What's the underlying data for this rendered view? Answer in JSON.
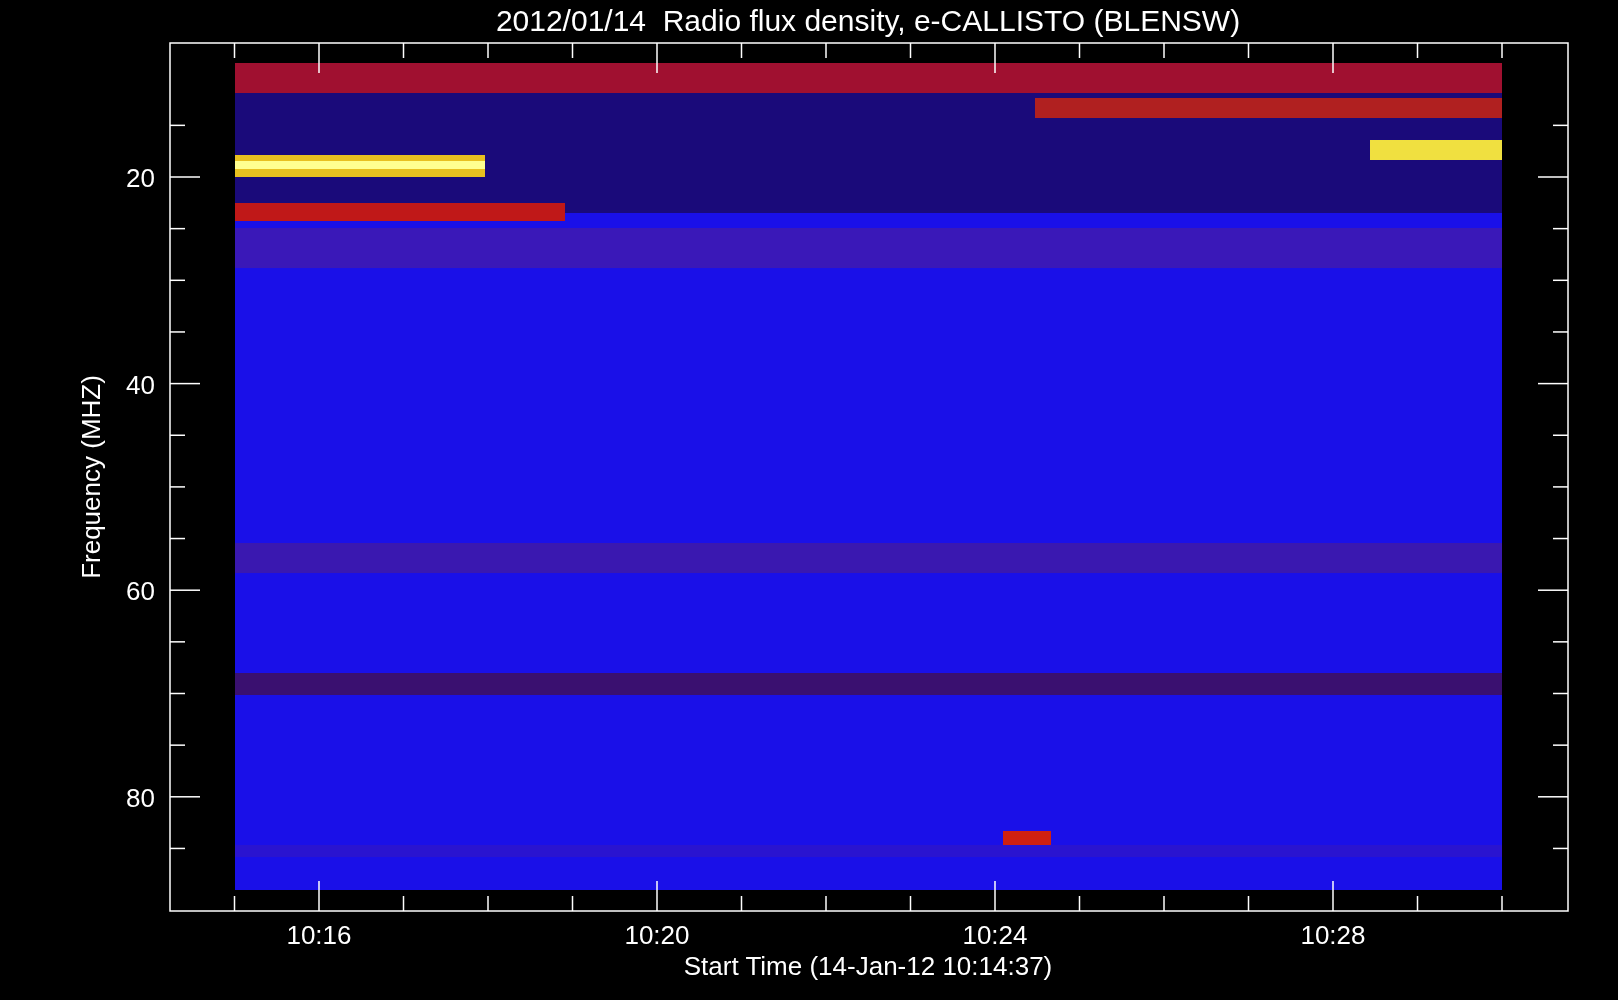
{
  "title": "2012/01/14  Radio flux density, e-CALLISTO (BLENSW)",
  "plot": {
    "kind": "spectrogram",
    "ylabel": "Frequency (MHZ)",
    "xlabel": "Start Time (14-Jan-12 10:14:37)",
    "yticks": [
      "20",
      "40",
      "60",
      "80"
    ],
    "xticks": [
      "10:16",
      "10:20",
      "10:24",
      "10:28"
    ]
  }
}
